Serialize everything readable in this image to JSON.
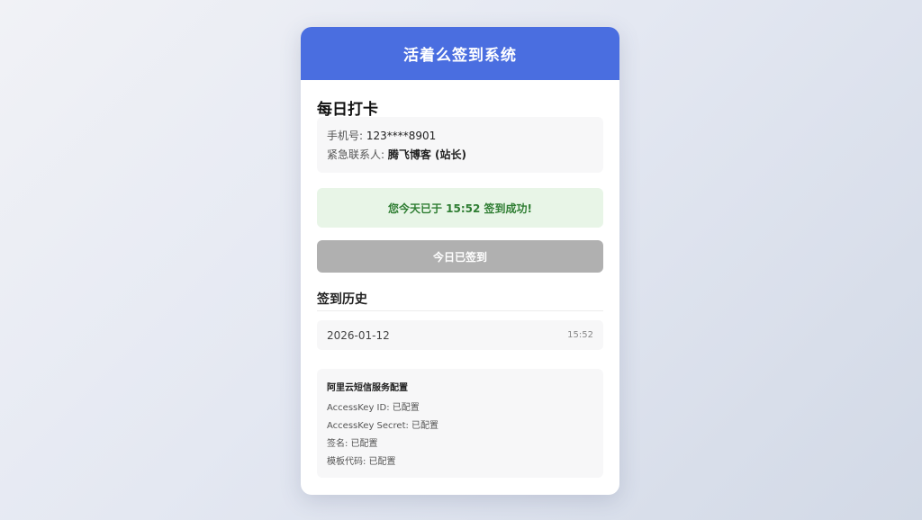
{
  "app": {
    "title": "活着么签到系统"
  },
  "checkin": {
    "section_title": "每日打卡",
    "phone_label": "手机号: ",
    "phone_value": "123****8901",
    "contact_label": "紧急联系人: ",
    "contact_value": "腾飞博客 (站长)",
    "success_message": "您今天已于 15:52 签到成功!",
    "button_label": "今日已签到",
    "button_disabled": true
  },
  "history": {
    "title": "签到历史",
    "records": [
      {
        "date": "2026-01-12",
        "time": "15:52"
      }
    ]
  },
  "sms_config": {
    "title": "阿里云短信服务配置",
    "lines": [
      "AccessKey ID: 已配置",
      "AccessKey Secret: 已配置",
      "签名: 已配置",
      "模板代码: 已配置"
    ]
  },
  "colors": {
    "header": "#4a6ee0",
    "success_bg": "#e8f5e7",
    "success_text": "#2e7d32",
    "button_disabled": "#b0b0b0"
  }
}
